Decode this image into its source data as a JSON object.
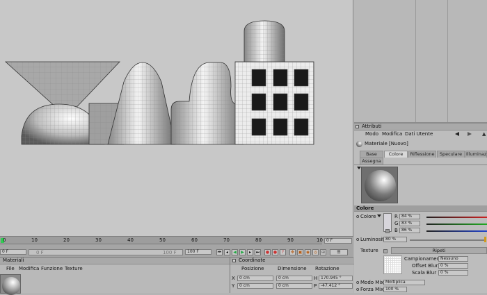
{
  "timeline": {
    "ticks": [
      "0",
      "10",
      "20",
      "30",
      "40",
      "50",
      "60",
      "70",
      "80",
      "90",
      "10"
    ],
    "current_frame": "0 F",
    "end_frame": "0 F",
    "start_field": "0 F",
    "range_left": "0 F",
    "range_right": "100 F",
    "max_field": "100 F"
  },
  "materials": {
    "title": "Materiali",
    "menu": [
      "File",
      "Modifica",
      "Funzione",
      "Texture"
    ]
  },
  "coords": {
    "title": "Coordinate",
    "headers": [
      "Posizione",
      "Dimensione",
      "Rotazione"
    ],
    "rows": [
      {
        "axis": "X",
        "pos": "0 cm",
        "size": "0 cm",
        "rot_axis": "H",
        "rot": "170.945 °"
      },
      {
        "axis": "Y",
        "pos": "0 cm",
        "size": "0 cm",
        "rot_axis": "P",
        "rot": "-47.412 °"
      }
    ]
  },
  "attributes": {
    "title": "Attributi",
    "menu": [
      "Modo",
      "Modifica",
      "Dati Utente"
    ],
    "material_name": "Materiale [Nuovo]",
    "tabs": [
      "Base",
      "Colore",
      "Riflessione",
      "Speculare",
      "Illuminazi"
    ],
    "tab2": "Assegna",
    "active_tab": "Colore",
    "section": "Colore",
    "color_label": "Colore",
    "channels": [
      {
        "label": "R",
        "value": "84 %",
        "color": "#cc2222"
      },
      {
        "label": "G",
        "value": "83 %",
        "color": "#22aa22"
      },
      {
        "label": "B",
        "value": "86 %",
        "color": "#2244cc"
      }
    ],
    "luminosity_label": "Luminosità",
    "luminosity_value": "80 %",
    "texture_label": "Texture",
    "ripeti": "Ripeti",
    "sampling_label": "Campionamento",
    "sampling_value": "Nessuno",
    "offset_blur_label": "Offset Blur",
    "offset_blur_value": "0 %",
    "scale_blur_label": "Scala Blur",
    "scale_blur_value": "0 %",
    "mix_mode_label": "Modo Mix",
    "mix_mode_value": "Moltiplica",
    "mix_force_label": "Forza Mix",
    "mix_force_value": "100 %"
  },
  "colors": {
    "viewport_bg": "#c8c8c8",
    "panel_bg": "#b9b9b9",
    "current_frame_marker": "#33cc55",
    "record_buttons": "#cc3333",
    "play_buttons": "#22aa44"
  }
}
